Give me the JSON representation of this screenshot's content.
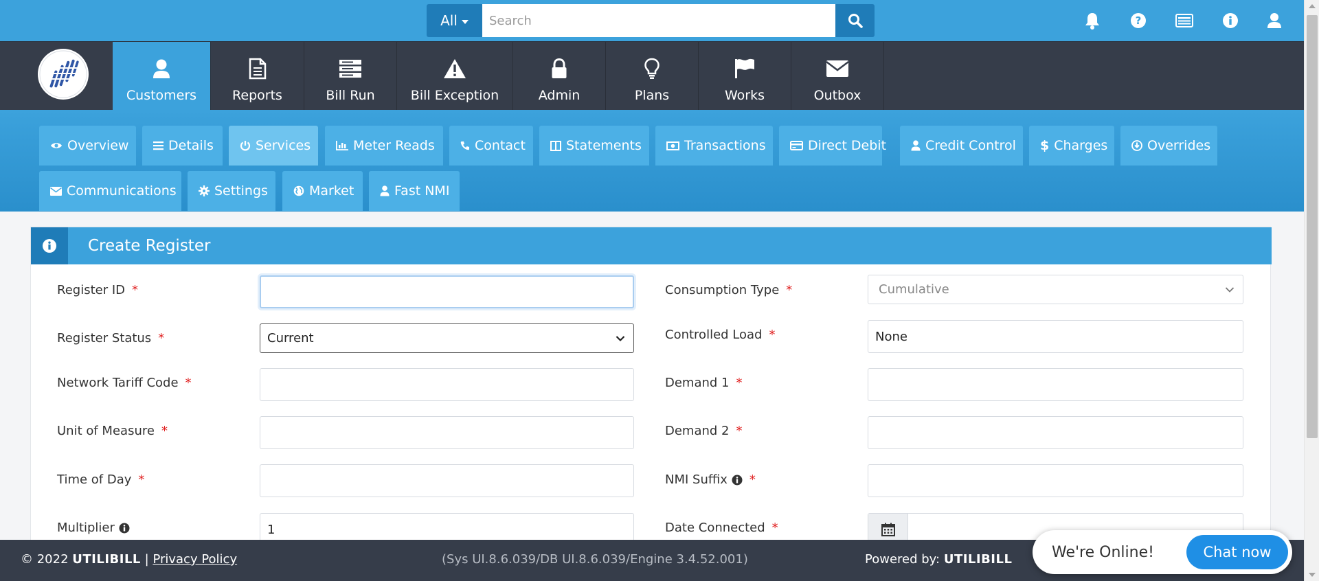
{
  "search": {
    "scope_label": "All",
    "placeholder": "Search",
    "value": ""
  },
  "top_icons": [
    "bell-icon",
    "help-icon",
    "billing-card-icon",
    "info-icon",
    "user-icon"
  ],
  "main_nav": [
    {
      "label": "Customers",
      "icon": "user-icon",
      "active": true
    },
    {
      "label": "Reports",
      "icon": "document-icon"
    },
    {
      "label": "Bill Run",
      "icon": "server-icon"
    },
    {
      "label": "Bill Exception",
      "icon": "warning-icon"
    },
    {
      "label": "Admin",
      "icon": "lock-icon"
    },
    {
      "label": "Plans",
      "icon": "lightbulb-icon"
    },
    {
      "label": "Works",
      "icon": "flag-icon"
    },
    {
      "label": "Outbox",
      "icon": "envelope-icon"
    }
  ],
  "sub_tabs": [
    {
      "label": "Overview",
      "icon": "eye-icon"
    },
    {
      "label": "Details",
      "icon": "list-icon"
    },
    {
      "label": "Services",
      "icon": "power-icon",
      "active": true
    },
    {
      "label": "Meter Reads",
      "icon": "bar-chart-icon"
    },
    {
      "label": "Contact",
      "icon": "phone-icon"
    },
    {
      "label": "Statements",
      "icon": "columns-icon"
    },
    {
      "label": "Transactions",
      "icon": "money-icon"
    },
    {
      "label": "Direct Debit",
      "icon": "credit-card-icon"
    },
    {
      "label": "Credit Control",
      "icon": "user-icon"
    },
    {
      "label": "Charges",
      "icon": "dollar-icon"
    },
    {
      "label": "Overrides",
      "icon": "download-circle-icon"
    },
    {
      "label": "Communications",
      "icon": "envelope-icon"
    },
    {
      "label": "Settings",
      "icon": "gear-icon"
    },
    {
      "label": "Market",
      "icon": "globe-icon"
    },
    {
      "label": "Fast NMI",
      "icon": "user-icon"
    }
  ],
  "panel": {
    "title": "Create Register",
    "icon": "info-icon"
  },
  "form": {
    "register_id": {
      "label": "Register ID",
      "value": ""
    },
    "register_status": {
      "label": "Register Status",
      "value": "Current"
    },
    "network_tariff_code": {
      "label": "Network Tariff Code",
      "value": ""
    },
    "unit_of_measure": {
      "label": "Unit of Measure",
      "value": ""
    },
    "time_of_day": {
      "label": "Time of Day",
      "value": ""
    },
    "multiplier": {
      "label": "Multiplier",
      "value": "1"
    },
    "consumption_type": {
      "label": "Consumption Type",
      "value": "Cumulative"
    },
    "controlled_load": {
      "label": "Controlled Load",
      "value": "None"
    },
    "demand_1": {
      "label": "Demand 1",
      "value": ""
    },
    "demand_2": {
      "label": "Demand 2",
      "value": ""
    },
    "nmi_suffix": {
      "label": "NMI Suffix",
      "value": ""
    },
    "date_connected": {
      "label": "Date Connected",
      "value": ""
    },
    "required_marker": "*"
  },
  "footer": {
    "copyright": "© 2022",
    "brand": "UTILIBILL",
    "separator": "|",
    "privacy_link": "Privacy Policy",
    "version": "(Sys UI.8.6.039/DB UI.8.6.039/Engine 3.4.52.001)",
    "powered_by": "Powered by:",
    "powered_brand": "UTILIBILL"
  },
  "chat": {
    "status": "We're Online!",
    "button": "Chat now"
  },
  "colors": {
    "primary": "#3ca2dc",
    "primary_dark": "#1f7cb8",
    "nav_bg": "#363d4a",
    "required": "#e02020",
    "chat_button": "#1f8fe5"
  }
}
